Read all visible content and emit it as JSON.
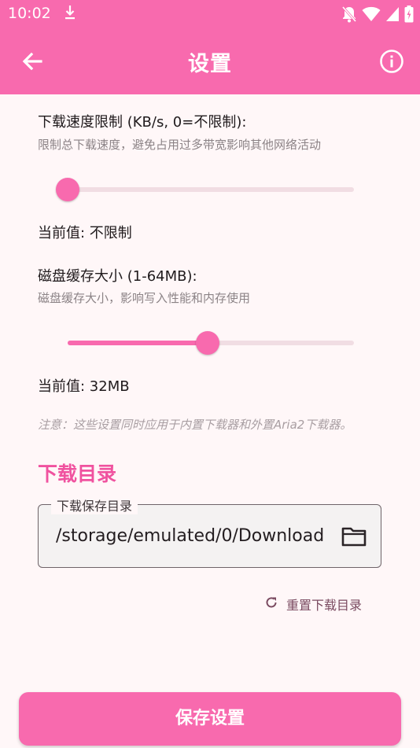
{
  "status_bar": {
    "time": "10:02",
    "icons": [
      "download-icon",
      "notifications-off-icon",
      "wifi-icon",
      "signal-icon",
      "battery-icon"
    ]
  },
  "app_bar": {
    "title": "设置",
    "back_icon": "arrow-back-icon",
    "info_icon": "info-icon"
  },
  "speed_limit": {
    "label": "下载速度限制 (KB/s, 0=不限制):",
    "description": "限制总下载速度，避免占用过多带宽影响其他网络活动",
    "current": "当前值: 不限制",
    "slider_fraction": 0.0
  },
  "disk_cache": {
    "label": "磁盘缓存大小 (1-64MB):",
    "description": "磁盘缓存大小，影响写入性能和内存使用",
    "current": "当前值: 32MB",
    "slider_fraction": 0.49
  },
  "note": "注意：这些设置同时应用于内置下载器和外置Aria2下载器。",
  "download_dir": {
    "section_title": "下载目录",
    "field_label": "下载保存目录",
    "field_value": "/storage/emulated/0/Download",
    "folder_icon": "folder-icon",
    "reset_label": "重置下载目录",
    "reset_icon": "refresh-icon"
  },
  "save_button": "保存设置",
  "colors": {
    "primary": "#f86aae",
    "section_title": "#f0529f",
    "background": "#fff7f8"
  }
}
